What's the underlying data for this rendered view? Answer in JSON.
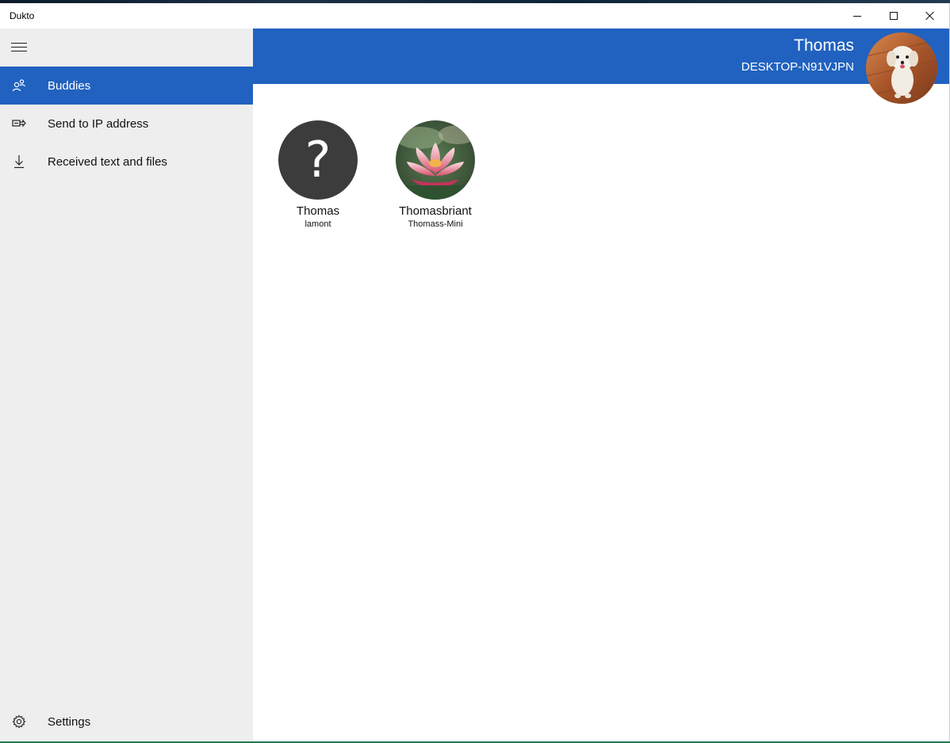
{
  "window": {
    "title": "Dukto"
  },
  "sidebar": {
    "items": [
      {
        "id": "buddies",
        "label": "Buddies",
        "icon": "buddies-icon",
        "active": true
      },
      {
        "id": "send-ip",
        "label": "Send to IP address",
        "icon": "send-ip-icon",
        "active": false
      },
      {
        "id": "received",
        "label": "Received text and files",
        "icon": "download-icon",
        "active": false
      }
    ],
    "settings": {
      "label": "Settings",
      "icon": "gear-icon"
    }
  },
  "header": {
    "user_name": "Thomas",
    "host_name": "DESKTOP-N91VJPN"
  },
  "buddies": [
    {
      "name": "Thomas",
      "host": "lamont",
      "avatar": "unknown-question-mark",
      "glyph": "?"
    },
    {
      "name": "Thomasbriant",
      "host": "Thomass-Mini",
      "avatar": "lotus-flower-photo"
    }
  ],
  "colors": {
    "accent": "#2162c0",
    "sidebar_bg": "#eeeeee",
    "unknown_avatar": "#3c3c3c"
  }
}
